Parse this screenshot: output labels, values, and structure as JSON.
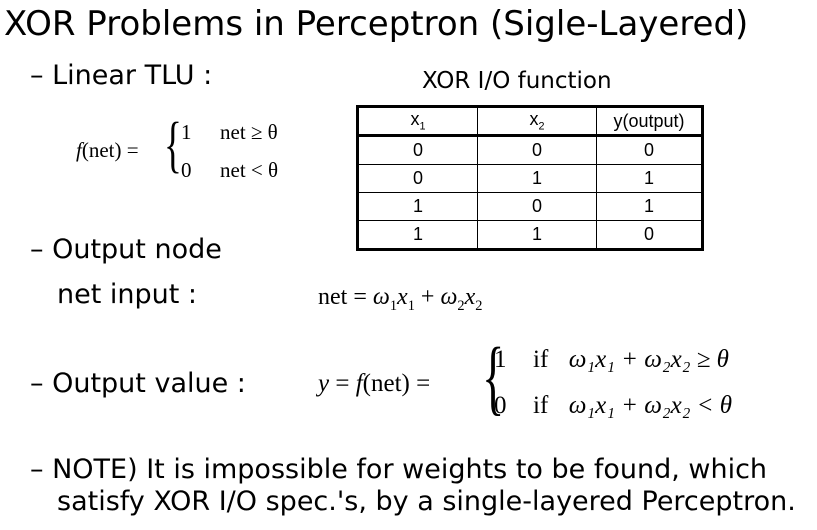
{
  "title": "XOR Problems in Perceptron (Sigle-Layered)",
  "bullets": {
    "dash": "–",
    "linear_tlu": "Linear TLU :",
    "output_node_line1": "Output node",
    "output_node_line2": "net input :",
    "output_value": "Output value :",
    "note_line1": "NOTE) It is impossible for weights to be found, which",
    "note_line2": "satisfy XOR I/O spec.'s, by a single-layered Perceptron."
  },
  "tlu_formula": {
    "lhs_f": "f",
    "lhs_arg": "(net) =",
    "case1_value": "1",
    "case1_cond": "net ≥ θ",
    "case2_value": "0",
    "case2_cond": "net < θ"
  },
  "net_formula": {
    "lhs": "net",
    "eq": "=",
    "w1": "ω",
    "w1_sub": "1",
    "x1": "x",
    "x1_sub": "1",
    "plus": "+",
    "w2": "ω",
    "w2_sub": "2",
    "x2": "x",
    "x2_sub": "2"
  },
  "output_formula": {
    "y": "y",
    "eq1": "=",
    "f": "f",
    "arg": "(net) =",
    "case1_value": "1",
    "case1_if": "if",
    "case1_expr": "ω₁x₁ + ω₂x₂ ≥ θ",
    "case2_value": "0",
    "case2_if": "if",
    "case2_expr": "ω₁x₁ + ω₂x₂ < θ"
  },
  "xor_table": {
    "caption": "XOR I/O function",
    "headers": [
      "x1",
      "x2",
      "y(output)"
    ],
    "rows": [
      [
        "0",
        "0",
        "0"
      ],
      [
        "0",
        "1",
        "1"
      ],
      [
        "1",
        "0",
        "1"
      ],
      [
        "1",
        "1",
        "0"
      ]
    ]
  }
}
